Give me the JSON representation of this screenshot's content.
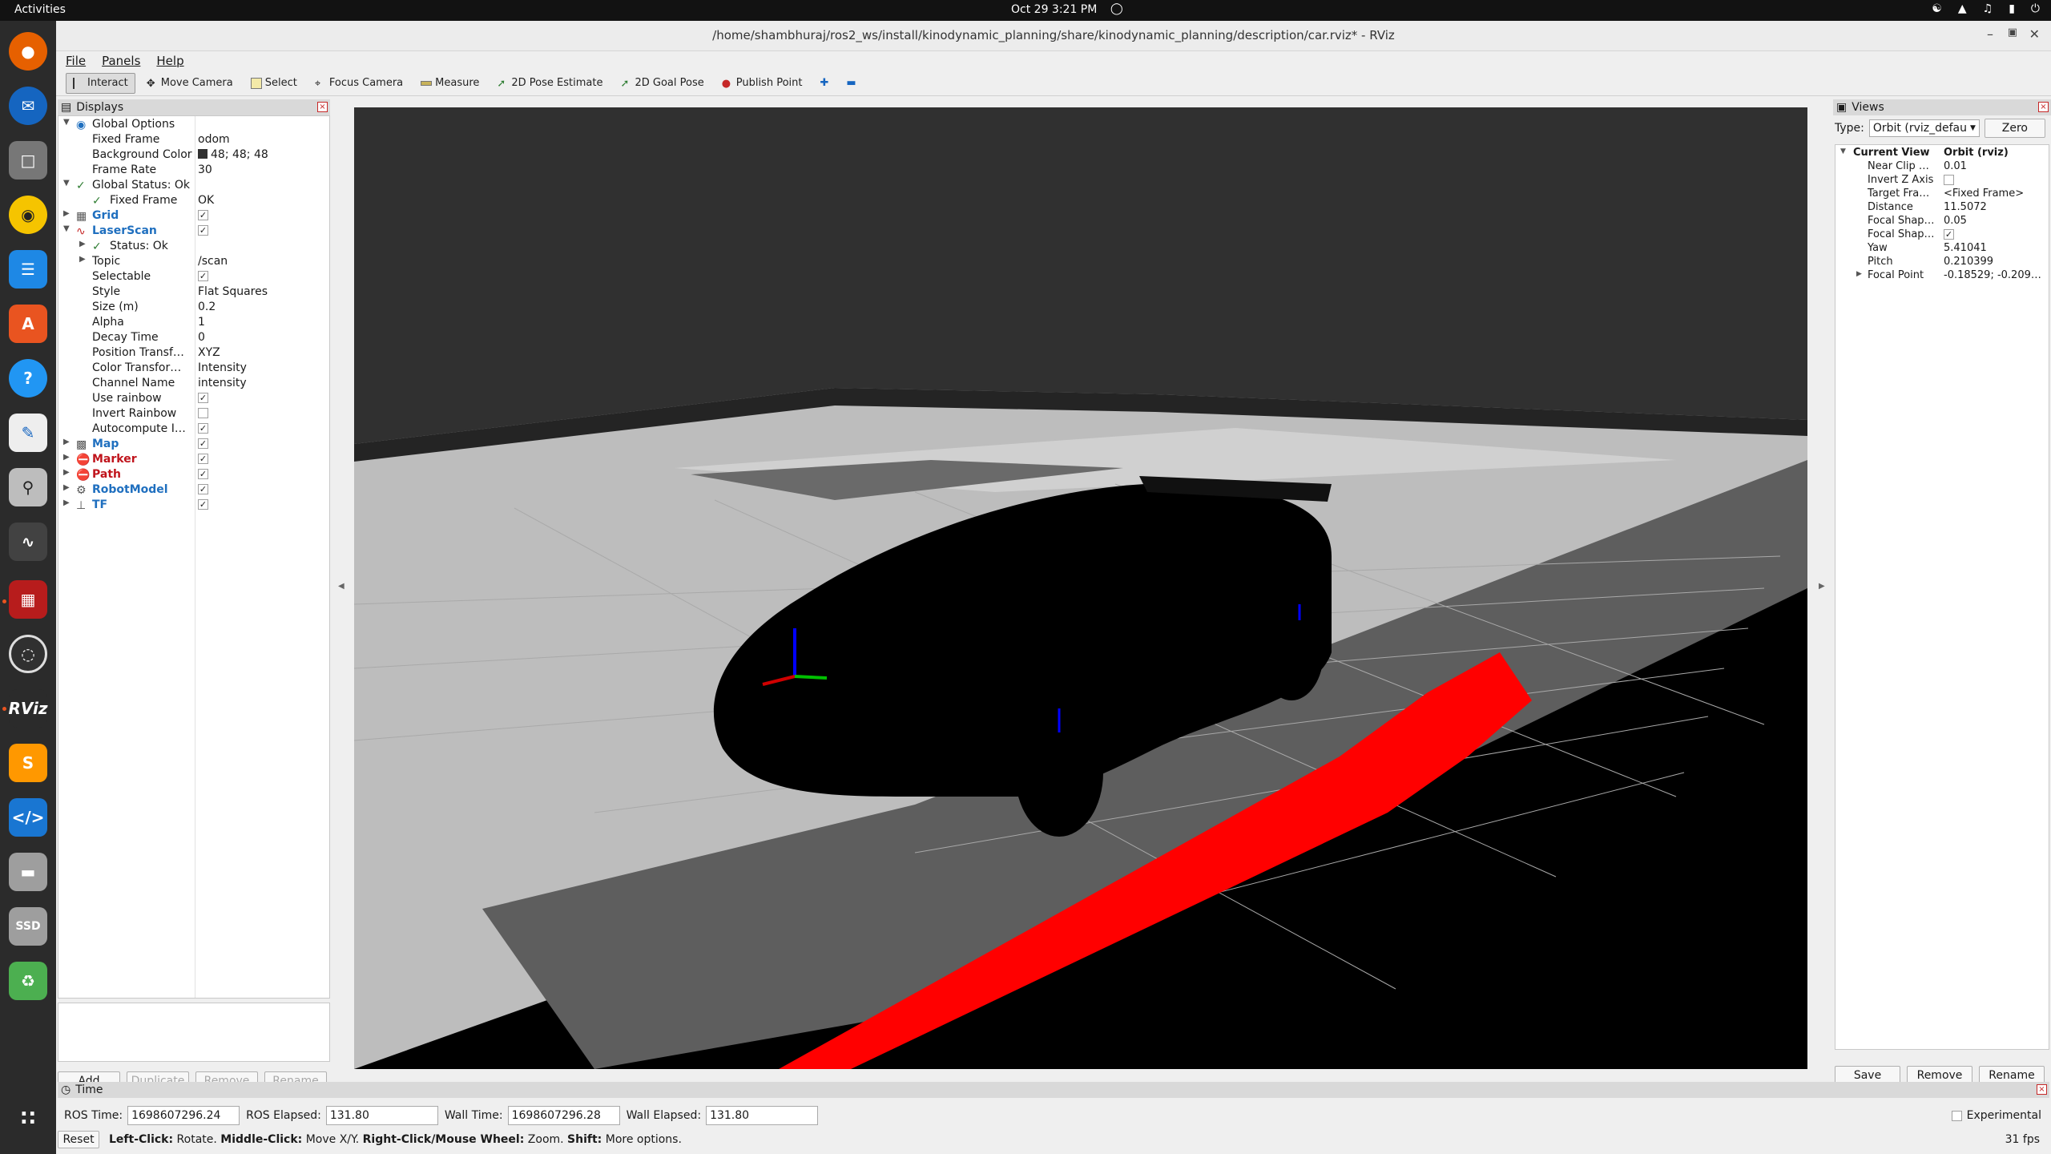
{
  "topbar": {
    "activities": "Activities",
    "clock": "Oct 29  3:21 PM"
  },
  "dock": {
    "apps": [
      "firefox-icon",
      "thunderbird-icon",
      "files-icon",
      "rhythmbox-icon",
      "libreoffice-writer-icon",
      "app-center-icon",
      "help-icon",
      "text-editor-icon",
      "search-icon",
      "system-monitor-icon",
      "gnome-terminal-icon",
      "obs-icon",
      "rviz-icon",
      "sublime-icon",
      "vscode-icon",
      "drive-icon",
      "ssd-icon",
      "trash-icon"
    ],
    "rviz_label": "RViz"
  },
  "window": {
    "title": "/home/shambhuraj/ros2_ws/install/kinodynamic_planning/share/kinodynamic_planning/description/car.rviz* - RViz",
    "menu": [
      "File",
      "Panels",
      "Help"
    ],
    "tools": [
      "Interact",
      "Move Camera",
      "Select",
      "Focus Camera",
      "Measure",
      "2D Pose Estimate",
      "2D Goal Pose",
      "Publish Point"
    ]
  },
  "displays": {
    "title": "Displays",
    "rows": [
      {
        "name": "Global Options",
        "value": ""
      },
      {
        "name": "Fixed Frame",
        "value": "odom"
      },
      {
        "name": "Background Color",
        "value": "48; 48; 48"
      },
      {
        "name": "Frame Rate",
        "value": "30"
      },
      {
        "name": "Global Status: Ok",
        "value": ""
      },
      {
        "name": "Fixed Frame",
        "value": "OK"
      },
      {
        "name": "Grid",
        "value": ""
      },
      {
        "name": "LaserScan",
        "value": ""
      },
      {
        "name": "Status: Ok",
        "value": ""
      },
      {
        "name": "Topic",
        "value": "/scan"
      },
      {
        "name": "Selectable",
        "value": ""
      },
      {
        "name": "Style",
        "value": "Flat Squares"
      },
      {
        "name": "Size (m)",
        "value": "0.2"
      },
      {
        "name": "Alpha",
        "value": "1"
      },
      {
        "name": "Decay Time",
        "value": "0"
      },
      {
        "name": "Position Transf…",
        "value": "XYZ"
      },
      {
        "name": "Color Transfor…",
        "value": "Intensity"
      },
      {
        "name": "Channel Name",
        "value": "intensity"
      },
      {
        "name": "Use rainbow",
        "value": ""
      },
      {
        "name": "Invert Rainbow",
        "value": ""
      },
      {
        "name": "Autocompute I…",
        "value": ""
      },
      {
        "name": "Map",
        "value": ""
      },
      {
        "name": "Marker",
        "value": ""
      },
      {
        "name": "Path",
        "value": ""
      },
      {
        "name": "RobotModel",
        "value": ""
      },
      {
        "name": "TF",
        "value": ""
      }
    ],
    "buttons": [
      "Add",
      "Duplicate",
      "Remove",
      "Rename"
    ]
  },
  "views": {
    "title": "Views",
    "type_label": "Type:",
    "type_value": "Orbit (rviz_defau",
    "zero": "Zero",
    "rows": [
      {
        "name": "Current View",
        "value": "Orbit (rviz)"
      },
      {
        "name": "Near Clip …",
        "value": "0.01"
      },
      {
        "name": "Invert Z Axis",
        "value": ""
      },
      {
        "name": "Target Fra…",
        "value": "<Fixed Frame>"
      },
      {
        "name": "Distance",
        "value": "11.5072"
      },
      {
        "name": "Focal Shap…",
        "value": "0.05"
      },
      {
        "name": "Focal Shap…",
        "value": ""
      },
      {
        "name": "Yaw",
        "value": "5.41041"
      },
      {
        "name": "Pitch",
        "value": "0.210399"
      },
      {
        "name": "Focal Point",
        "value": "-0.18529; -0.209…"
      }
    ],
    "buttons": [
      "Save",
      "Remove",
      "Rename"
    ]
  },
  "time": {
    "title": "Time",
    "ros_time_label": "ROS Time:",
    "ros_time": "1698607296.24",
    "ros_elapsed_label": "ROS Elapsed:",
    "ros_elapsed": "131.80",
    "wall_time_label": "Wall Time:",
    "wall_time": "1698607296.28",
    "wall_elapsed_label": "Wall Elapsed:",
    "wall_elapsed": "131.80",
    "experimental": "Experimental"
  },
  "status": {
    "reset": "Reset",
    "left_click": "Left-Click:",
    "left_desc": "Rotate.",
    "middle_click": "Middle-Click:",
    "middle_desc": "Move X/Y.",
    "right_click": "Right-Click/Mouse Wheel:",
    "right_desc": "Zoom.",
    "shift": "Shift:",
    "shift_desc": "More options.",
    "fps": "31 fps"
  },
  "colors": {
    "laser": "#ff0000",
    "grid": "#a0a0a0",
    "background": "#303030",
    "accent_blue": "#1f6fbf"
  }
}
